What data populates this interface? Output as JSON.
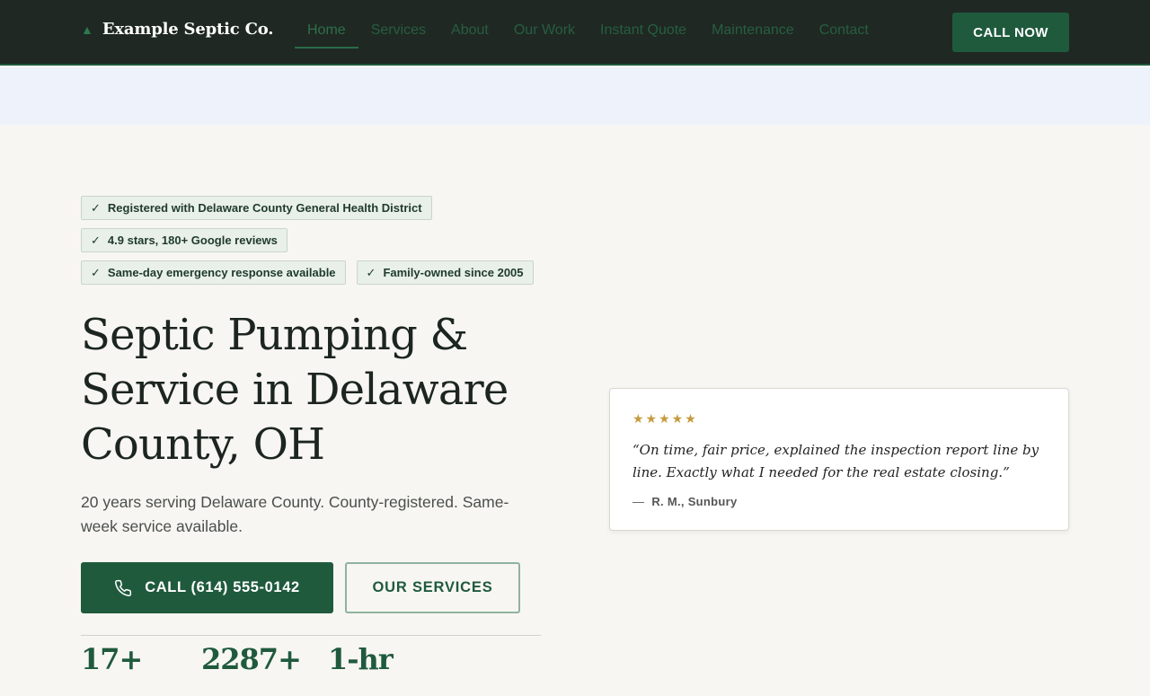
{
  "header": {
    "brand": "Example Septic Co.",
    "logo_icon": "tree-icon",
    "nav": [
      {
        "label": "Home",
        "active": true
      },
      {
        "label": "Services"
      },
      {
        "label": "About"
      },
      {
        "label": "Our Work"
      },
      {
        "label": "Instant Quote"
      },
      {
        "label": "Maintenance"
      },
      {
        "label": "Contact"
      }
    ],
    "cta": "CALL NOW"
  },
  "hero": {
    "badges": [
      "Registered with Delaware County General Health District",
      "4.9 stars, 180+ Google reviews",
      "Same-day emergency response available",
      "Family-owned since 2005"
    ],
    "headline": "Septic Pumping & Service in Delaware County, OH",
    "subhead": "20 years serving Delaware County. County-registered. Same-week service available.",
    "call_button": "CALL (614) 555-0142",
    "call_icon": "phone-icon",
    "services_button": "OUR SERVICES",
    "stats": [
      "17+",
      "2287+",
      "1-hr"
    ]
  },
  "review": {
    "stars": "★★★★★",
    "rating": 5,
    "quote": "“On time, fair price, explained the inspection report line by line. Exactly what I needed for the real estate closing.”",
    "dash": "—",
    "author": "R. M., Sunbury"
  },
  "colors": {
    "header_bg": "#1f2823",
    "brand_green": "#1f5a3d",
    "band_bg": "#eef3fb",
    "page_bg": "#f8f6f2",
    "star_gold": "#c79a3f"
  }
}
